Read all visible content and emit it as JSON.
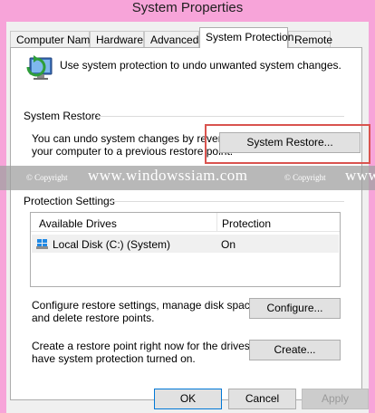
{
  "window": {
    "title": "System Properties"
  },
  "tabs": [
    {
      "label": "Computer Name"
    },
    {
      "label": "Hardware"
    },
    {
      "label": "Advanced"
    },
    {
      "label": "System Protection"
    },
    {
      "label": "Remote"
    }
  ],
  "intro": {
    "text": "Use system protection to undo unwanted system changes."
  },
  "system_restore": {
    "group_label": "System Restore",
    "description_line1": "You can undo system changes by reverting",
    "description_line2": "your computer to a previous restore point.",
    "button_label": "System Restore..."
  },
  "watermark": {
    "copyright": "© Copyright",
    "site": "www.windowssiam.com",
    "copyright2": "© Copyright",
    "site2": "www"
  },
  "protection_settings": {
    "group_label": "Protection Settings",
    "columns": [
      "Available Drives",
      "Protection"
    ],
    "rows": [
      {
        "drive": "Local Disk (C:) (System)",
        "protection": "On"
      }
    ],
    "configure_text_line1": "Configure restore settings, manage disk space,",
    "configure_text_line2": "and delete restore points.",
    "configure_button": "Configure...",
    "create_text_line1": "Create a restore point right now for the drives that",
    "create_text_line2": "have system protection turned on.",
    "create_button": "Create..."
  },
  "footer": {
    "ok": "OK",
    "cancel": "Cancel",
    "apply": "Apply"
  },
  "colors": {
    "title_bar": "#f7a4d9",
    "highlight": "#d9534f",
    "focus": "#0078d7"
  }
}
